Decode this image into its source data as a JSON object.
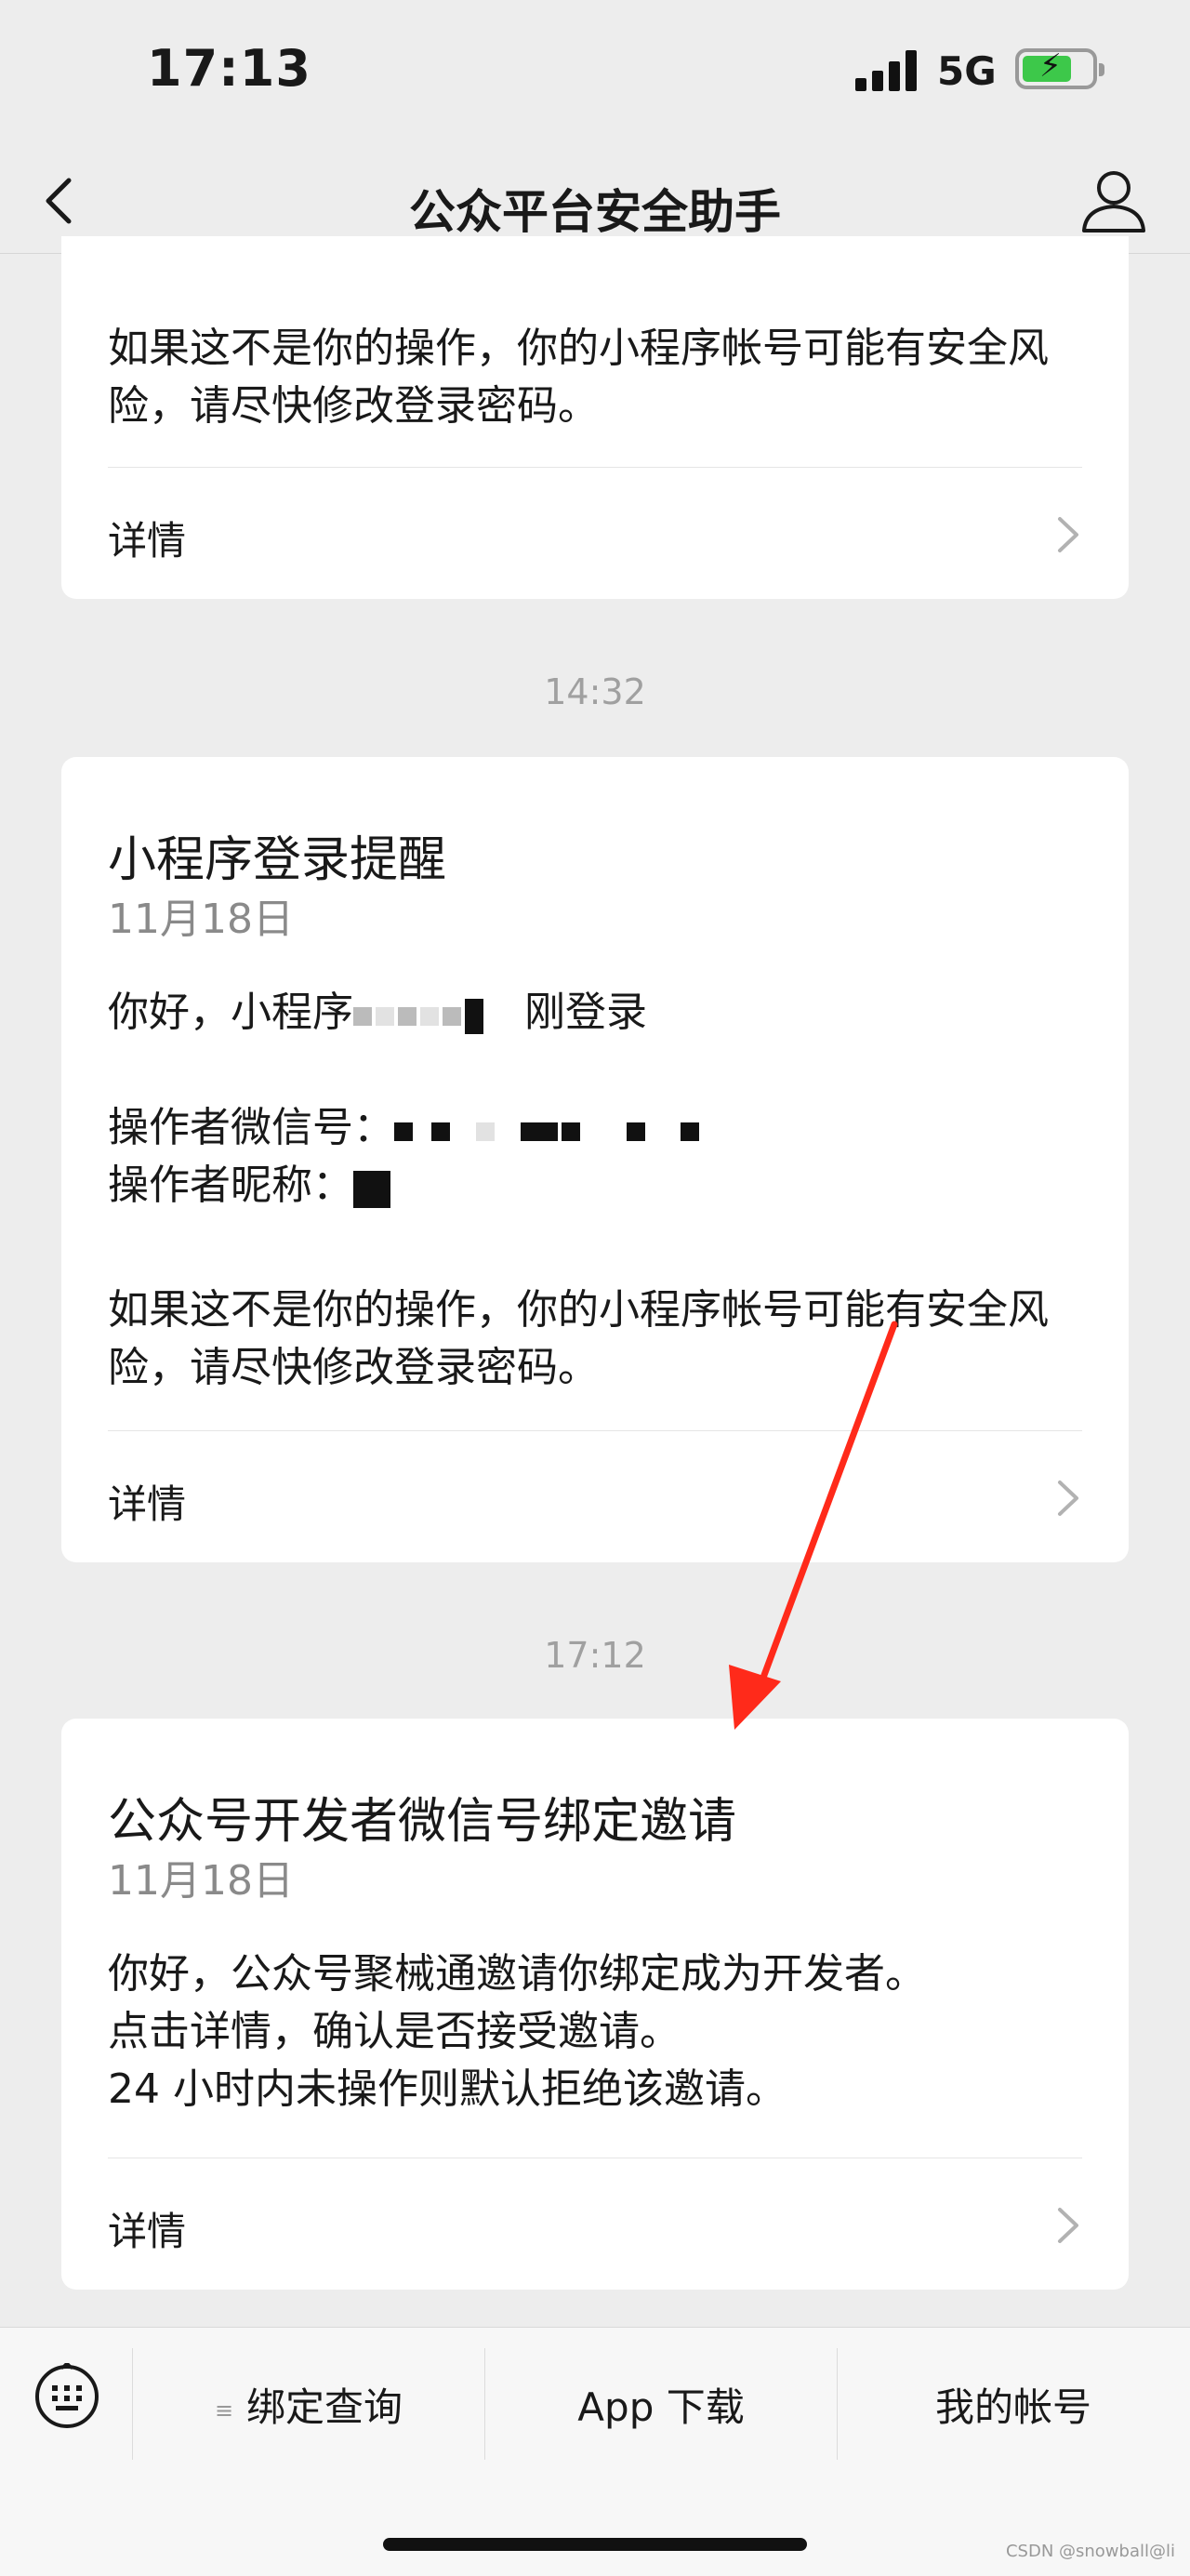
{
  "status_bar": {
    "time": "17:13",
    "network": "5G"
  },
  "nav": {
    "title": "公众平台安全助手"
  },
  "card_top": {
    "warning": "如果这不是你的操作，你的小程序帐号可能有安全风险，请尽快修改登录密码。",
    "detail_label": "详情"
  },
  "timestamp_1": "14:32",
  "card_login": {
    "title": "小程序登录提醒",
    "date": "11月18日",
    "greeting_prefix": "你好，小程序",
    "greeting_suffix": "刚登录",
    "operator_wechat_label": "操作者微信号：",
    "operator_nickname_label": "操作者昵称：",
    "warning": "如果这不是你的操作，你的小程序帐号可能有安全风险，请尽快修改登录密码。",
    "detail_label": "详情"
  },
  "timestamp_2": "17:12",
  "card_invite": {
    "title": "公众号开发者微信号绑定邀请",
    "date": "11月18日",
    "line1": "你好，公众号聚械通邀请你绑定成为开发者。",
    "line2": "点击详情，确认是否接受邀请。",
    "line3": "24 小时内未操作则默认拒绝该邀请。",
    "detail_label": "详情"
  },
  "bottom_menu": {
    "items": [
      {
        "label": "绑定查询",
        "icon": "menu-list-icon"
      },
      {
        "label": "App 下载"
      },
      {
        "label": "我的帐号"
      }
    ]
  },
  "watermark": "CSDN @snowball@li",
  "colors": {
    "background": "#ededed",
    "card": "#ffffff",
    "arrow": "#ff2a1a",
    "battery": "#3dc84a"
  }
}
